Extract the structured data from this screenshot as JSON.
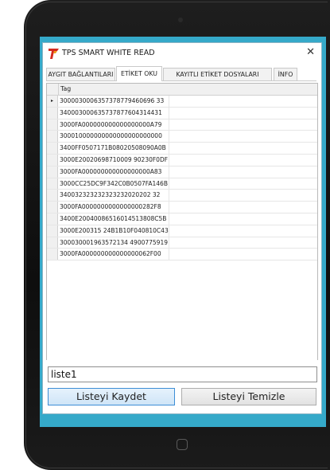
{
  "window": {
    "title": "TPS SMART WHITE READ",
    "close_glyph": "✕"
  },
  "tabs": [
    {
      "label": "AYGIT BAĞLANTILARI",
      "active": false
    },
    {
      "label": "ETİKET OKU",
      "active": true
    },
    {
      "label": "KAYITLI ETİKET DOSYALARI",
      "active": false
    },
    {
      "label": "İNFO",
      "active": false
    }
  ],
  "grid": {
    "column_header": "Tag",
    "current_row_marker": "▸",
    "rows": [
      "3000030006357378779460696 33",
      "340003000635737877604314431",
      "3000FA000000000000000000A79",
      "300010000000000000000000000",
      "3400FF0507171B08020508090A0B",
      "3000E20020698710009 90230F0DF",
      "3000FA000000000000000000A83",
      "3000CC25DC9F342C0B0507FA146B",
      "340032323232323232020202 32",
      "3000FA0000000000000000282F8",
      "3400E20040086516014513808C5B",
      "3000E200315 24B1B10F040810C43",
      "300030001963572134 4900775919",
      "3000FA000000000000000062F00"
    ]
  },
  "list_name_input": {
    "value": "liste1"
  },
  "buttons": {
    "save_label": "Listeyi Kaydet",
    "clear_label": "Listeyi Temizle"
  },
  "icons": {
    "app_logo": "tps-logo-icon",
    "home": "home-button-icon"
  },
  "colors": {
    "screen_background": "#35a9c9",
    "save_button_border": "#3d8ed6",
    "logo_red": "#d42a1f",
    "logo_orange": "#f29a1d"
  }
}
